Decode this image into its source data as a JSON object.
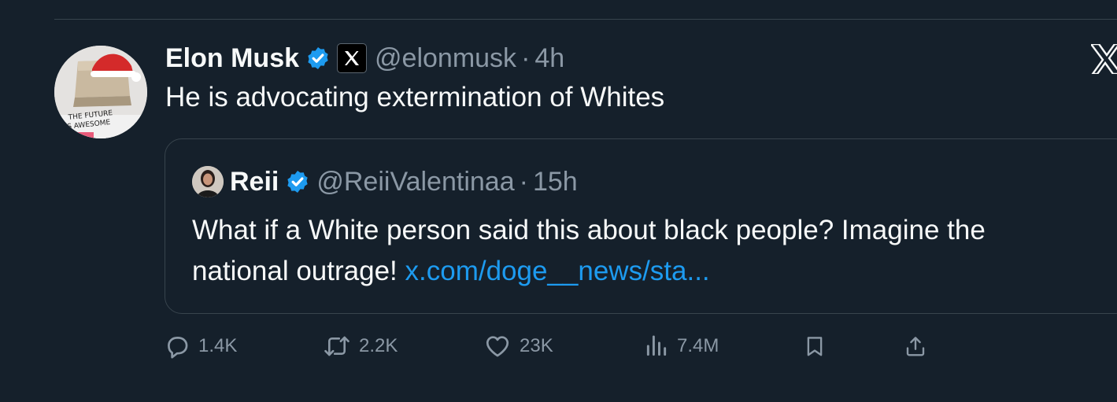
{
  "tweet": {
    "author_name": "Elon Musk",
    "author_handle": "@elonmusk",
    "separator": "·",
    "time": "4h",
    "text": "He is advocating extermination of Whites",
    "avatar_caption_line1": "THE FUTURE",
    "avatar_caption_line2": "IS AWESOME"
  },
  "quoted": {
    "author_name": "Reii",
    "author_handle": "@ReiiValentinaa",
    "separator": "·",
    "time": "15h",
    "text_line1": "What if a White person said this about black people? Imagine the",
    "text_line2": "national outrage!",
    "link": "x.com/doge__news/sta..."
  },
  "actions": {
    "replies": "1.4K",
    "reposts": "2.2K",
    "likes": "23K",
    "views": "7.4M"
  },
  "colors": {
    "background": "#15202b",
    "text": "#f7f9f9",
    "muted": "#8b98a5",
    "accent": "#1d9bf0",
    "border": "#38444d"
  },
  "icons": {
    "verified": "verified-badge-icon",
    "affiliate": "x-logo-icon",
    "reply": "reply-icon",
    "repost": "repost-icon",
    "like": "heart-icon",
    "views": "views-icon",
    "bookmark": "bookmark-icon",
    "share": "share-icon"
  }
}
